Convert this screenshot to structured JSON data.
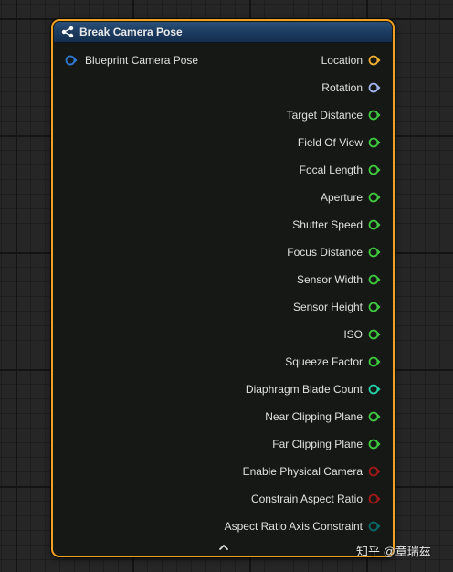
{
  "node": {
    "title": "Break Camera Pose",
    "header_color": "#1b3a5e",
    "border_color": "#f0a020",
    "icon": "function-node-icon",
    "input_pin": {
      "label": "Blueprint Camera Pose",
      "color": "#2e7bd6"
    },
    "output_pins": [
      {
        "name": "location",
        "label": "Location",
        "color": "#f0b030"
      },
      {
        "name": "rotation",
        "label": "Rotation",
        "color": "#a0b4f0"
      },
      {
        "name": "target-distance",
        "label": "Target Distance",
        "color": "#3fc93f"
      },
      {
        "name": "field-of-view",
        "label": "Field Of View",
        "color": "#3fc93f"
      },
      {
        "name": "focal-length",
        "label": "Focal Length",
        "color": "#3fc93f"
      },
      {
        "name": "aperture",
        "label": "Aperture",
        "color": "#3fc93f"
      },
      {
        "name": "shutter-speed",
        "label": "Shutter Speed",
        "color": "#3fc93f"
      },
      {
        "name": "focus-distance",
        "label": "Focus Distance",
        "color": "#3fc93f"
      },
      {
        "name": "sensor-width",
        "label": "Sensor Width",
        "color": "#3fc93f"
      },
      {
        "name": "sensor-height",
        "label": "Sensor Height",
        "color": "#3fc93f"
      },
      {
        "name": "iso",
        "label": "ISO",
        "color": "#3fc93f"
      },
      {
        "name": "squeeze-factor",
        "label": "Squeeze Factor",
        "color": "#3fc93f"
      },
      {
        "name": "diaphragm-blade-count",
        "label": "Diaphragm Blade Count",
        "color": "#24d0a8"
      },
      {
        "name": "near-clipping-plane",
        "label": "Near Clipping Plane",
        "color": "#3fc93f"
      },
      {
        "name": "far-clipping-plane",
        "label": "Far Clipping Plane",
        "color": "#3fc93f"
      },
      {
        "name": "enable-physical-camera",
        "label": "Enable Physical Camera",
        "color": "#a01818"
      },
      {
        "name": "constrain-aspect-ratio",
        "label": "Constrain Aspect Ratio",
        "color": "#a01818"
      },
      {
        "name": "aspect-ratio-axis-constraint",
        "label": "Aspect Ratio Axis Constraint",
        "color": "#0a6a6a"
      }
    ],
    "collapse_icon": "chevron-up-icon"
  },
  "watermark": {
    "text": "知乎 @章瑞兹"
  }
}
